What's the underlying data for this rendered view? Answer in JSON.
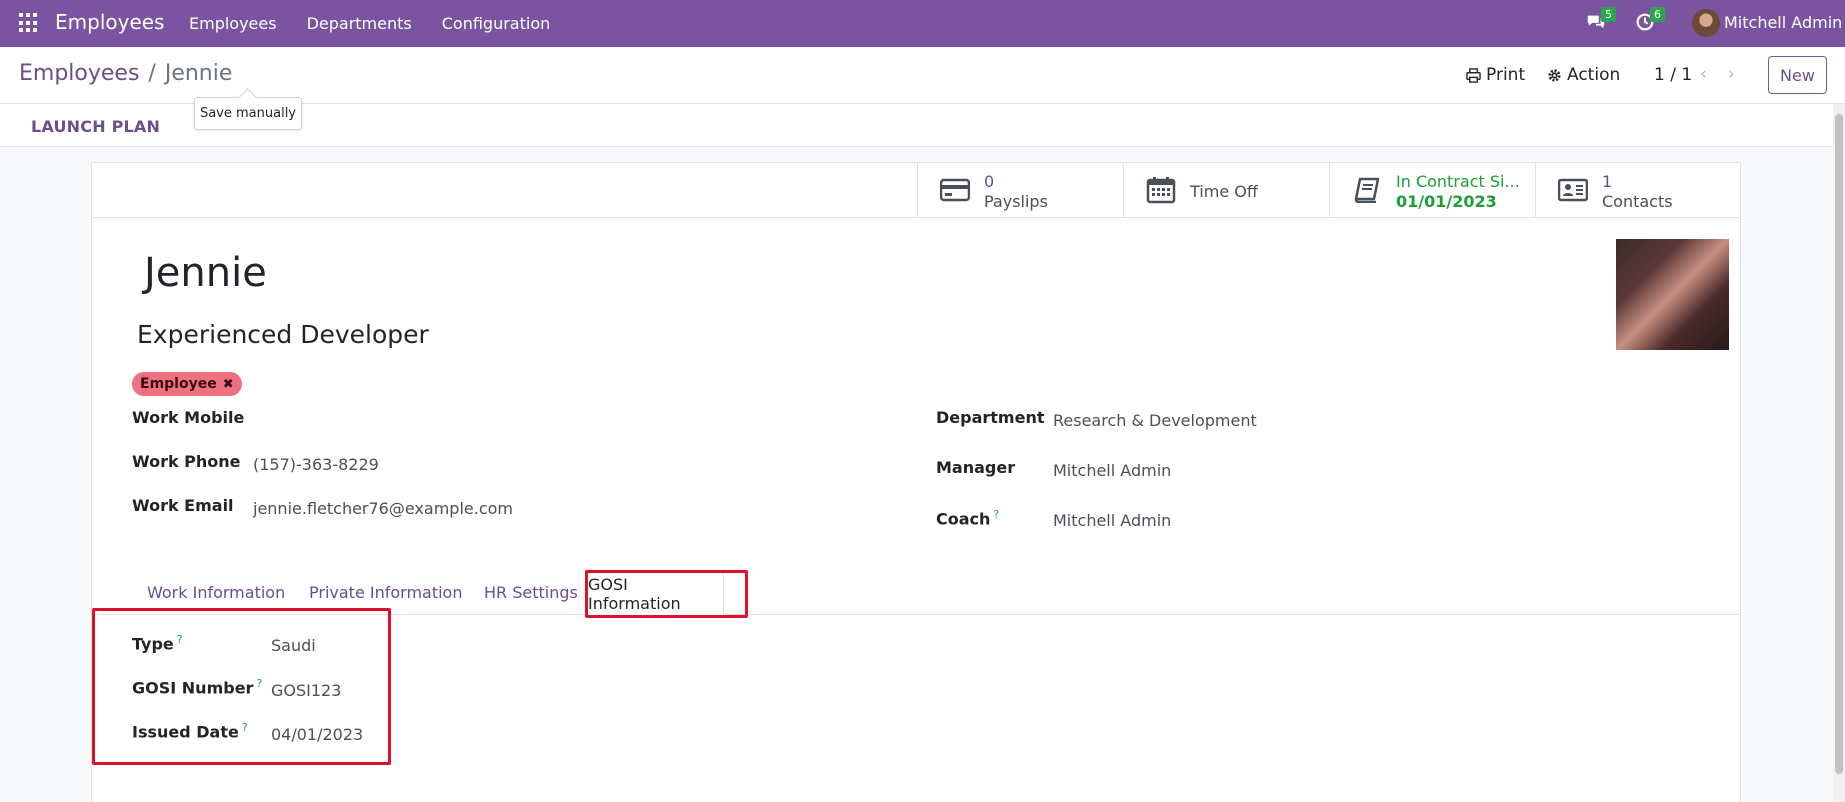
{
  "navbar": {
    "brand": "Employees",
    "menu": [
      "Employees",
      "Departments",
      "Configuration"
    ],
    "messages_count": "5",
    "activities_count": "6",
    "user_name": "Mitchell Admin",
    "icons": [
      "apps-icon",
      "chat-icon",
      "clock-icon",
      "avatar"
    ]
  },
  "control_panel": {
    "breadcrumb_parent": "Employees",
    "breadcrumb_sep": "/",
    "breadcrumb_current": "Jennie",
    "tooltip": "Save manually",
    "print_label": "Print",
    "action_label": "Action",
    "pager": "1 / 1",
    "new_label": "New"
  },
  "statusbar": {
    "launch_plan": "LAUNCH PLAN"
  },
  "stat_buttons": [
    {
      "value": "0",
      "label": "Payslips",
      "icon": "credit-card-icon"
    },
    {
      "value": "",
      "label": "Time Off",
      "icon": "calendar-icon"
    },
    {
      "value": "In Contract Si...",
      "label": "01/01/2023",
      "icon": "book-icon"
    },
    {
      "value": "1",
      "label": "Contacts",
      "icon": "contact-card-icon"
    }
  ],
  "employee": {
    "name": "Jennie",
    "job_title": "Experienced Developer",
    "tag": "Employee"
  },
  "fields_left": [
    {
      "label": "Work Mobile",
      "value": ""
    },
    {
      "label": "Work Phone",
      "value": "(157)-363-8229"
    },
    {
      "label": "Work Email",
      "value": "jennie.fletcher76@example.com"
    }
  ],
  "fields_right": [
    {
      "label": "Department",
      "value": "Research & Development"
    },
    {
      "label": "Manager",
      "value": "Mitchell Admin"
    },
    {
      "label": "Coach",
      "value": "Mitchell Admin",
      "help": "?"
    }
  ],
  "tabs": [
    "Work Information",
    "Private Information",
    "HR Settings",
    "GOSI Information"
  ],
  "gosi": [
    {
      "label": "Type",
      "value": "Saudi",
      "help": "?"
    },
    {
      "label": "GOSI Number",
      "value": "GOSI123",
      "help": "?"
    },
    {
      "label": "Issued Date",
      "value": "04/01/2023",
      "help": "?"
    }
  ],
  "colors": {
    "navbar": "#7a54a0",
    "accent": "#6c4e8a",
    "highlight": "#e0102a",
    "tag": "#ef7180",
    "contract_green": "#1f9d3a"
  }
}
